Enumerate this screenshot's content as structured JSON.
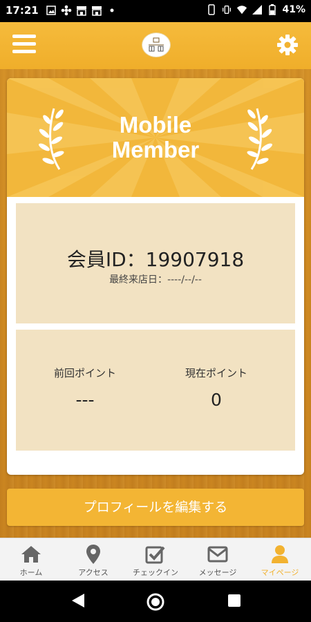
{
  "status_bar": {
    "time": "17:21",
    "battery_text": "41%"
  },
  "header": {
    "menu_icon": "hamburger-menu-icon",
    "logo_icon": "restaurant-logo-icon",
    "settings_icon": "gear-icon"
  },
  "member_card": {
    "banner_title_line1": "Mobile",
    "banner_title_line2": "Member",
    "member_id_label": "会員ID：",
    "member_id_value": "19907918",
    "last_visit_label": "最終来店日：",
    "last_visit_value": "----/--/--",
    "previous_points_label": "前回ポイント",
    "previous_points_value": "---",
    "current_points_label": "現在ポイント",
    "current_points_value": "0"
  },
  "edit_profile_button_label": "プロフィールを編集する",
  "bottom_nav": {
    "items": [
      {
        "label": "ホーム",
        "icon": "home-icon"
      },
      {
        "label": "アクセス",
        "icon": "map-pin-icon"
      },
      {
        "label": "チェックイン",
        "icon": "checkbox-icon"
      },
      {
        "label": "メッセージ",
        "icon": "envelope-icon"
      },
      {
        "label": "マイページ",
        "icon": "user-icon"
      }
    ],
    "active_index": 4
  },
  "colors": {
    "accent": "#f2b230",
    "card_panel": "#f2e2c2",
    "wood": "#cf8a22"
  }
}
